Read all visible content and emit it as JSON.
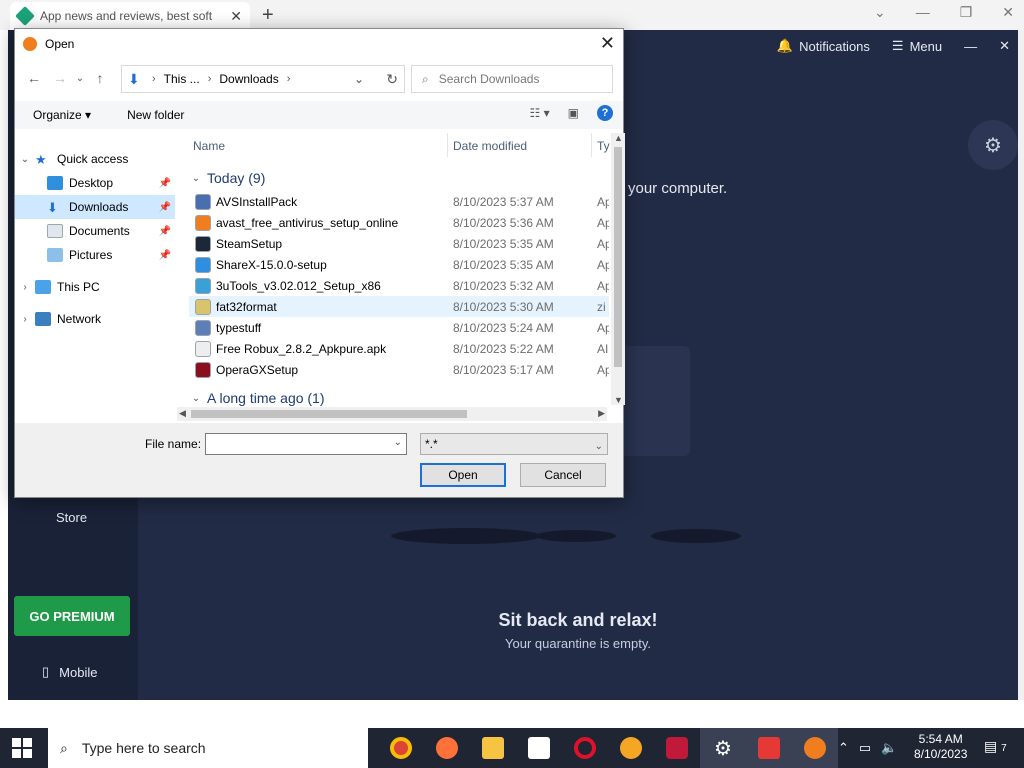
{
  "browser": {
    "tab_title": "App news and reviews, best soft",
    "tab_close": "✕",
    "new_tab": "+"
  },
  "app": {
    "notifications": "Notifications",
    "menu": "Menu",
    "computer_text": "your computer.",
    "store": "Store",
    "go_premium": "GO PREMIUM",
    "mobile": "Mobile",
    "relax_title": "Sit back and relax!",
    "relax_sub": "Your quarantine is empty."
  },
  "dialog": {
    "title": "Open",
    "address": [
      "This ...",
      "Downloads"
    ],
    "search_placeholder": "Search Downloads",
    "organize": "Organize",
    "new_folder": "New folder",
    "nav": {
      "quick_access": "Quick access",
      "desktop": "Desktop",
      "downloads": "Downloads",
      "documents": "Documents",
      "pictures": "Pictures",
      "this_pc": "This PC",
      "network": "Network"
    },
    "columns": {
      "name": "Name",
      "date": "Date modified",
      "type": "Ty"
    },
    "groups": {
      "today": "Today (9)",
      "long_ago": "A long time ago (1)"
    },
    "files": [
      {
        "name": "AVSInstallPack",
        "date": "8/10/2023 5:37 AM",
        "type": "Ap",
        "color": "#4a6fb0"
      },
      {
        "name": "avast_free_antivirus_setup_online",
        "date": "8/10/2023 5:36 AM",
        "type": "Ap",
        "color": "#f07d1e"
      },
      {
        "name": "SteamSetup",
        "date": "8/10/2023 5:35 AM",
        "type": "Ap",
        "color": "#1b2838"
      },
      {
        "name": "ShareX-15.0.0-setup",
        "date": "8/10/2023 5:35 AM",
        "type": "Ap",
        "color": "#2f8fdc"
      },
      {
        "name": "3uTools_v3.02.012_Setup_x86",
        "date": "8/10/2023 5:32 AM",
        "type": "Ap",
        "color": "#3aa0d8"
      },
      {
        "name": "fat32format",
        "date": "8/10/2023 5:30 AM",
        "type": "zi",
        "color": "#d8c46a"
      },
      {
        "name": "typestuff",
        "date": "8/10/2023 5:24 AM",
        "type": "Ap",
        "color": "#5c7fb8"
      },
      {
        "name": "Free Robux_2.8.2_Apkpure.apk",
        "date": "8/10/2023 5:22 AM",
        "type": "AI",
        "color": "#eeeeee"
      },
      {
        "name": "OperaGXSetup",
        "date": "8/10/2023 5:17 AM",
        "type": "Ap",
        "color": "#8a1020"
      }
    ],
    "file_name_label": "File name:",
    "file_name_value": "",
    "filter": "*.*",
    "open_btn": "Open",
    "cancel_btn": "Cancel"
  },
  "taskbar": {
    "search_placeholder": "Type here to search",
    "time": "5:54 AM",
    "date": "8/10/2023",
    "notif_count": "7"
  }
}
